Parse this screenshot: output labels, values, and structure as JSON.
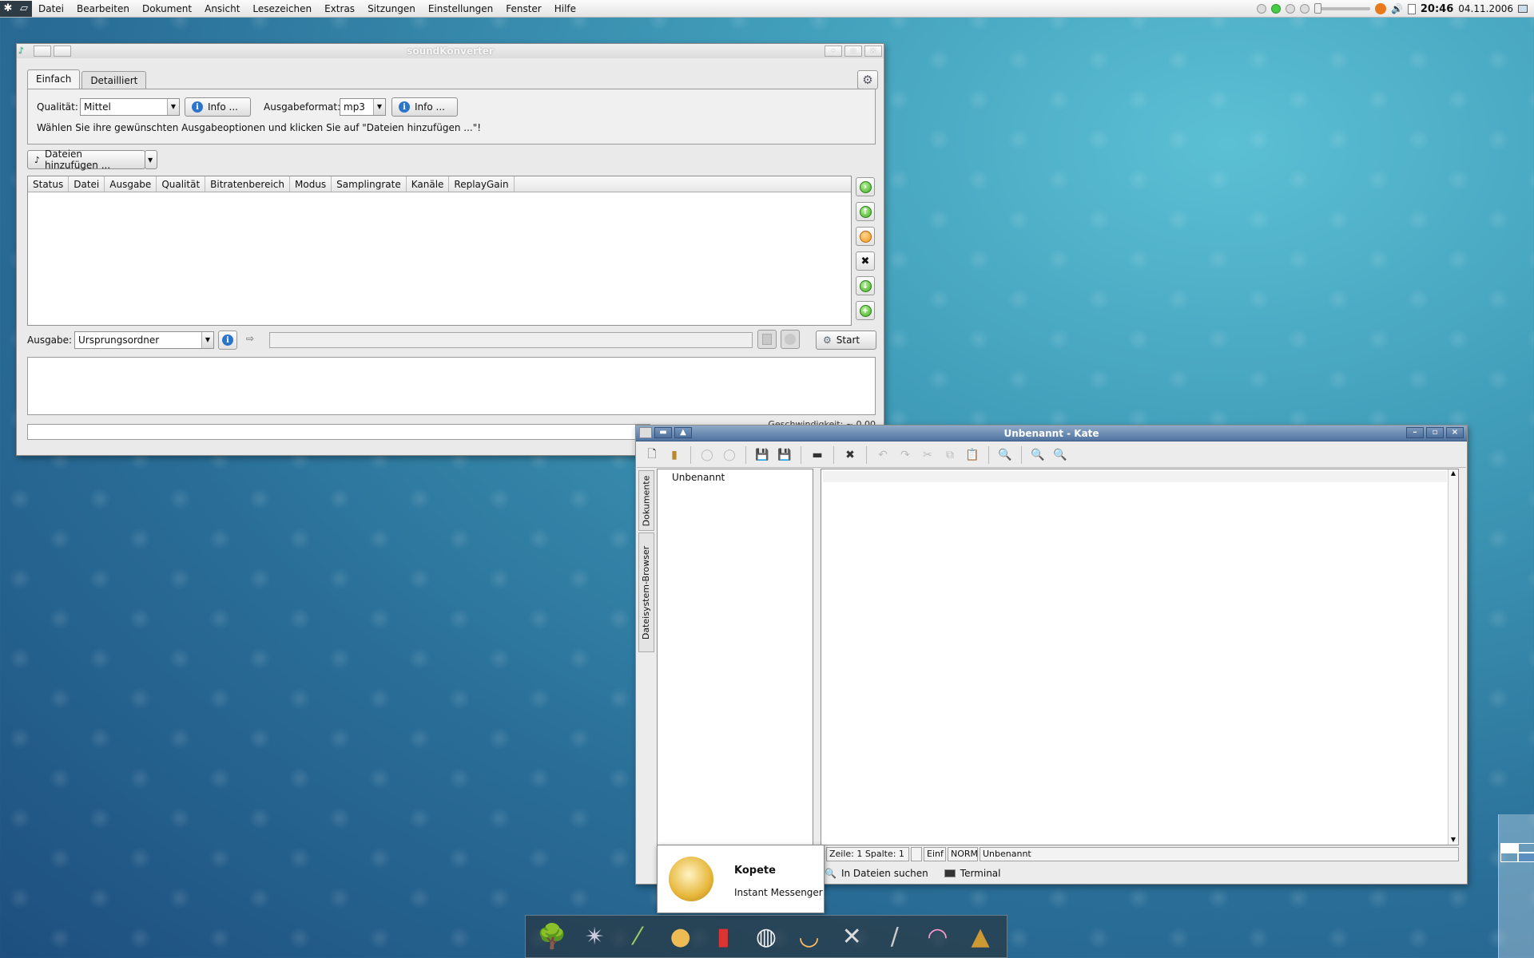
{
  "menubar": {
    "items": [
      "Datei",
      "Bearbeiten",
      "Dokument",
      "Ansicht",
      "Lesezeichen",
      "Extras",
      "Sitzungen",
      "Einstellungen",
      "Fenster",
      "Hilfe"
    ],
    "clock": "20:46",
    "date": "04.11.2006"
  },
  "soundkonverter": {
    "title": "soundKonverter",
    "tabs": [
      "Einfach",
      "Detailliert"
    ],
    "quality_label": "Qualität:",
    "quality_value": "Mittel",
    "info_button": "Info ...",
    "format_label": "Ausgabeformat:",
    "format_value": "mp3",
    "info_button2": "Info ...",
    "hint": "Wählen Sie ihre gewünschten Ausgabeoptionen und klicken Sie auf \"Dateien hinzufügen ...\"!",
    "add_files": "Dateien hinzufügen ...",
    "columns": [
      "Status",
      "Datei",
      "Ausgabe",
      "Qualität",
      "Bitratenbereich",
      "Modus",
      "Samplingrate",
      "Kanäle",
      "ReplayGain"
    ],
    "output_label": "Ausgabe:",
    "output_value": "Ursprungsordner",
    "start_button": "Start",
    "speed_label": "Geschwindigkeit: ~ 0.00"
  },
  "kate": {
    "title": "Unbenannt - Kate",
    "vtab_documents": "Dokumente",
    "vtab_filebrowser": "Dateisystem-Browser",
    "document_item": "Unbenannt",
    "status_position": "Zeile: 1 Spalte: 1",
    "status_mode": "Einf",
    "status_norm": "NORM",
    "status_filename": "Unbenannt",
    "bottom_search": "In Dateien suchen",
    "bottom_terminal": "Terminal"
  },
  "tooltip": {
    "title": "Kopete",
    "subtitle": "Instant Messenger"
  },
  "colors": {
    "kate_titlebar": "#4f73a0",
    "desktop": "#2a6f98"
  }
}
